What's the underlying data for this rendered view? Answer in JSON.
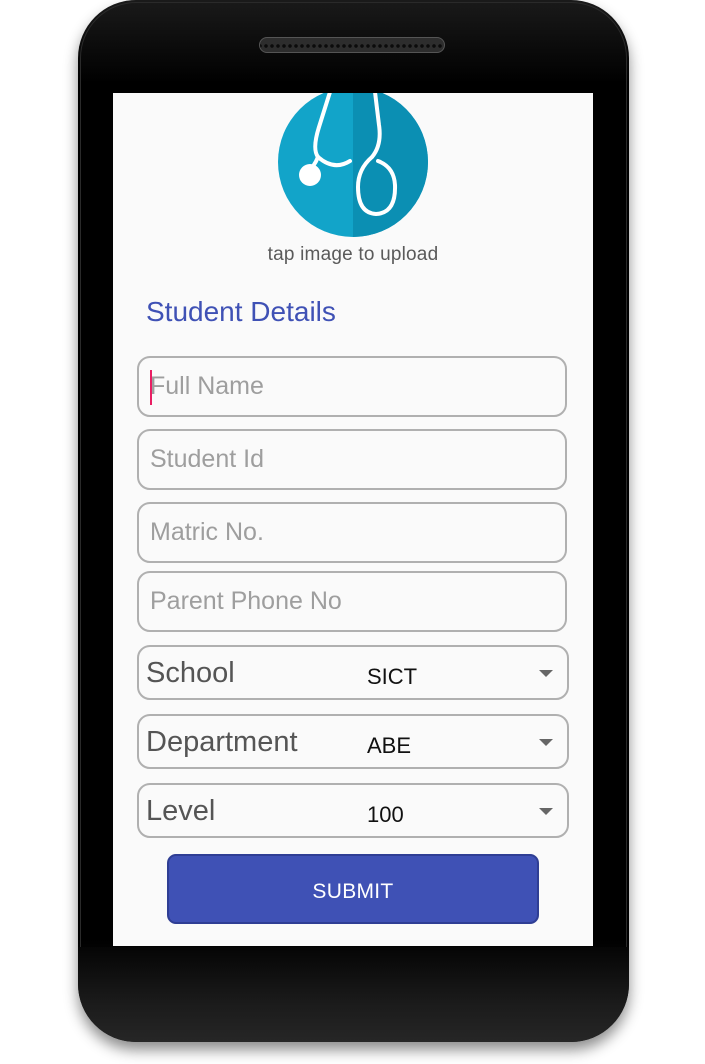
{
  "header": {
    "upload_hint": "tap image to upload",
    "avatar_icon": "stethoscope-icon"
  },
  "form": {
    "title": "Student Details",
    "fields": [
      {
        "placeholder": "Full Name",
        "value": ""
      },
      {
        "placeholder": "Student Id",
        "value": ""
      },
      {
        "placeholder": "Matric No.",
        "value": ""
      },
      {
        "placeholder": "Parent Phone No",
        "value": ""
      }
    ],
    "selects": [
      {
        "label": "School",
        "value": "SICT"
      },
      {
        "label": "Department",
        "value": "ABE"
      },
      {
        "label": "Level",
        "value": "100"
      }
    ],
    "submit_label": "SUBMIT"
  },
  "colors": {
    "accent": "#3f51b5",
    "avatar_bg": "#12a4c9",
    "cursor": "#e91e63"
  }
}
